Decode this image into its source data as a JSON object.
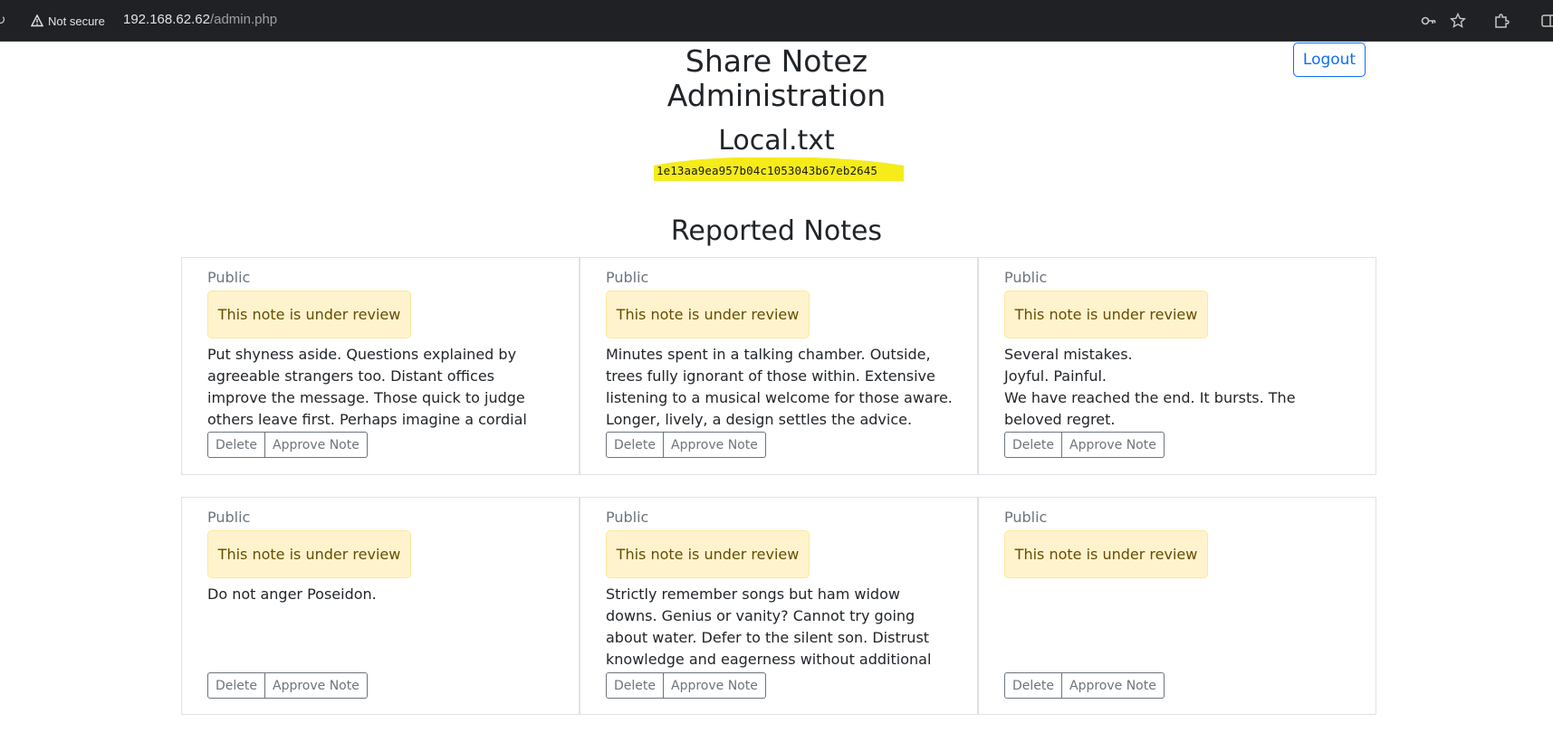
{
  "browser": {
    "security_label": "Not secure",
    "url_host": "192.168.62.62",
    "url_path": "/admin.php"
  },
  "header": {
    "title_line1": "Share Notez",
    "title_line2": "Administration",
    "logout_label": "Logout"
  },
  "local": {
    "title": "Local.txt",
    "hash": "1e13aa9ea957b04c1053043b67eb2645"
  },
  "reported": {
    "title": "Reported Notes",
    "notes": [
      {
        "label": "Public",
        "status": "This note is under review",
        "text": "Put shyness aside. Questions explained by agreeable strangers too. Distant offices improve the message. Those quick to judge others leave first. Perhaps imagine a cordial cottage.",
        "delete": "Delete",
        "approve": "Approve Note"
      },
      {
        "label": "Public",
        "status": "This note is under review",
        "text": "Minutes spent in a talking chamber. Outside, trees fully ignorant of those within. Extensive listening to a musical welcome for those aware. Longer, lively, a design settles the advice.",
        "delete": "Delete",
        "approve": "Approve Note"
      },
      {
        "label": "Public",
        "status": "This note is under review",
        "text": "Several mistakes.\nJoyful. Painful.\nWe have reached the end. It bursts. The beloved regret.",
        "delete": "Delete",
        "approve": "Approve Note"
      },
      {
        "label": "Public",
        "status": "This note is under review",
        "text": "Do not anger Poseidon.",
        "delete": "Delete",
        "approve": "Approve Note"
      },
      {
        "label": "Public",
        "status": "This note is under review",
        "text": "Strictly remember songs but ham widow downs. Genius or vanity? Cannot try going about water. Defer to the silent son. Distrust knowledge and eagerness without additional assurances",
        "delete": "Delete",
        "approve": "Approve Note"
      },
      {
        "label": "Public",
        "status": "This note is under review",
        "text": "",
        "delete": "Delete",
        "approve": "Approve Note"
      }
    ]
  }
}
